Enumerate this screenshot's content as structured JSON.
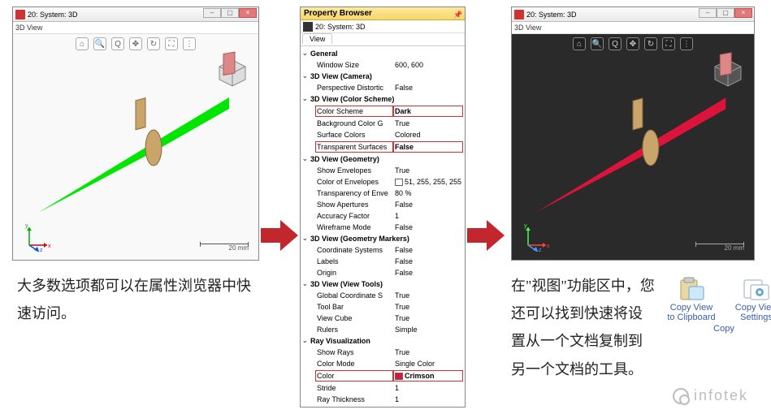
{
  "window_left": {
    "title": "20: System: 3D",
    "subtitle": "3D View",
    "scale": "20 mm"
  },
  "window_right": {
    "title": "20: System: 3D",
    "subtitle": "3D View",
    "scale": "20 mm"
  },
  "toolbar_icons": [
    "⌂",
    "🔍",
    "Q",
    "✥",
    "↻",
    "⛶",
    "⋮"
  ],
  "axes": {
    "x": "x",
    "y": "y",
    "z": "z"
  },
  "property_browser": {
    "title": "Property Browser",
    "subtitle": "20: System: 3D",
    "tab": "View",
    "groups": [
      {
        "name": "General",
        "items": [
          {
            "label": "Window Size",
            "value": "600, 600"
          }
        ]
      },
      {
        "name": "3D View (Camera)",
        "items": [
          {
            "label": "Perspective Distortic",
            "value": "False"
          }
        ]
      },
      {
        "name": "3D View (Color Scheme)",
        "items": [
          {
            "label": "Color Scheme",
            "value": "Dark",
            "hl": true
          },
          {
            "label": "Background Color G",
            "value": "True"
          },
          {
            "label": "Surface Colors",
            "value": "Colored"
          },
          {
            "label": "Transparent Surfaces",
            "value": "False",
            "hl": true
          }
        ]
      },
      {
        "name": "3D View (Geometry)",
        "items": [
          {
            "label": "Show Envelopes",
            "value": "True"
          },
          {
            "label": "Color of Envelopes",
            "value": "51, 255, 255, 255",
            "swatch": true
          },
          {
            "label": "Transparency of Enve",
            "value": "80 %"
          },
          {
            "label": "Show Apertures",
            "value": "False"
          },
          {
            "label": "Accuracy Factor",
            "value": "1"
          },
          {
            "label": "Wireframe Mode",
            "value": "False"
          }
        ]
      },
      {
        "name": "3D View (Geometry Markers)",
        "items": [
          {
            "label": "Coordinate Systems",
            "value": "False"
          },
          {
            "label": "Labels",
            "value": "False"
          },
          {
            "label": "Origin",
            "value": "False"
          }
        ]
      },
      {
        "name": "3D View (View Tools)",
        "items": [
          {
            "label": "Global Coordinate S",
            "value": "True"
          },
          {
            "label": "Tool Bar",
            "value": "True"
          },
          {
            "label": "View Cube",
            "value": "True"
          },
          {
            "label": "Rulers",
            "value": "Simple"
          }
        ]
      },
      {
        "name": "Ray Visualization",
        "items": [
          {
            "label": "Show Rays",
            "value": "True"
          },
          {
            "label": "Color Mode",
            "value": "Single Color"
          },
          {
            "label": "Color",
            "value": "Crimson",
            "hl": true,
            "swatch_color": "#dc143c"
          },
          {
            "label": "Stride",
            "value": "1"
          },
          {
            "label": "Ray Thickness",
            "value": "1"
          }
        ]
      }
    ]
  },
  "caption_left": "大多数选项都可以在属性浏览器中快速访问。",
  "caption_right": "在\"视图\"功能区中，您还可以找到快速将设置从一个文档复制到另一个文档的工具。",
  "copy_group": {
    "item1_l1": "Copy View",
    "item1_l2": "to Clipboard",
    "item2_l1": "Copy View",
    "item2_l2": "Settings",
    "label": "Copy"
  },
  "watermark": "infotek"
}
